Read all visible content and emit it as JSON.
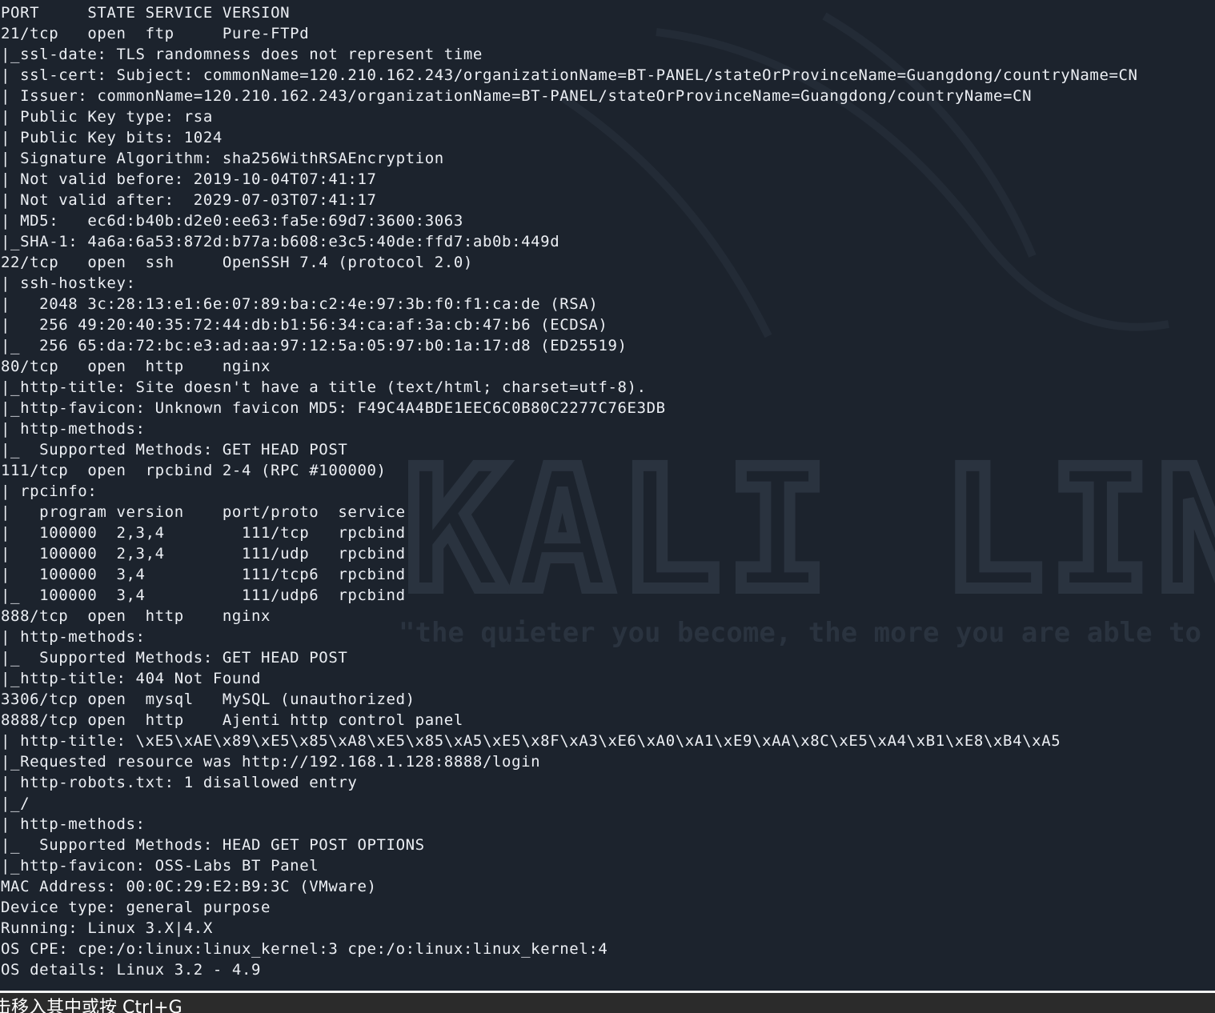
{
  "terminal": {
    "lines": [
      "PORT     STATE SERVICE VERSION",
      "21/tcp   open  ftp     Pure-FTPd",
      "|_ssl-date: TLS randomness does not represent time",
      "| ssl-cert: Subject: commonName=120.210.162.243/organizationName=BT-PANEL/stateOrProvinceName=Guangdong/countryName=CN",
      "| Issuer: commonName=120.210.162.243/organizationName=BT-PANEL/stateOrProvinceName=Guangdong/countryName=CN",
      "| Public Key type: rsa",
      "| Public Key bits: 1024",
      "| Signature Algorithm: sha256WithRSAEncryption",
      "| Not valid before: 2019-10-04T07:41:17",
      "| Not valid after:  2029-07-03T07:41:17",
      "| MD5:   ec6d:b40b:d2e0:ee63:fa5e:69d7:3600:3063",
      "|_SHA-1: 4a6a:6a53:872d:b77a:b608:e3c5:40de:ffd7:ab0b:449d",
      "22/tcp   open  ssh     OpenSSH 7.4 (protocol 2.0)",
      "| ssh-hostkey:",
      "|   2048 3c:28:13:e1:6e:07:89:ba:c2:4e:97:3b:f0:f1:ca:de (RSA)",
      "|   256 49:20:40:35:72:44:db:b1:56:34:ca:af:3a:cb:47:b6 (ECDSA)",
      "|_  256 65:da:72:bc:e3:ad:aa:97:12:5a:05:97:b0:1a:17:d8 (ED25519)",
      "80/tcp   open  http    nginx",
      "|_http-title: Site doesn't have a title (text/html; charset=utf-8).",
      "|_http-favicon: Unknown favicon MD5: F49C4A4BDE1EEC6C0B80C2277C76E3DB",
      "| http-methods:",
      "|_  Supported Methods: GET HEAD POST",
      "111/tcp  open  rpcbind 2-4 (RPC #100000)",
      "| rpcinfo:",
      "|   program version    port/proto  service",
      "|   100000  2,3,4        111/tcp   rpcbind",
      "|   100000  2,3,4        111/udp   rpcbind",
      "|   100000  3,4          111/tcp6  rpcbind",
      "|_  100000  3,4          111/udp6  rpcbind",
      "888/tcp  open  http    nginx",
      "| http-methods:",
      "|_  Supported Methods: GET HEAD POST",
      "|_http-title: 404 Not Found",
      "3306/tcp open  mysql   MySQL (unauthorized)",
      "8888/tcp open  http    Ajenti http control panel",
      "| http-title: \\xE5\\xAE\\x89\\xE5\\x85\\xA8\\xE5\\x85\\xA5\\xE5\\x8F\\xA3\\xE6\\xA0\\xA1\\xE9\\xAA\\x8C\\xE5\\xA4\\xB1\\xE8\\xB4\\xA5",
      "|_Requested resource was http://192.168.1.128:8888/login",
      "| http-robots.txt: 1 disallowed entry",
      "|_/",
      "| http-methods:",
      "|_  Supported Methods: HEAD GET POST OPTIONS",
      "|_http-favicon: OSS-Labs BT Panel",
      "MAC Address: 00:0C:29:E2:B9:3C (VMware)",
      "Device type: general purpose",
      "Running: Linux 3.X|4.X",
      "OS CPE: cpe:/o:linux:linux_kernel:3 cpe:/o:linux:linux_kernel:4",
      "OS details: Linux 3.2 - 4.9"
    ]
  },
  "wallpaper": {
    "logo_text": "KALI LINUX",
    "quote": "\"the quieter you become, the more you are able to h"
  },
  "statusbar": {
    "text": "击移入其中或按 Ctrl+G"
  },
  "colors": {
    "terminal_background": "#1c232d",
    "terminal_foreground": "#eceff4",
    "watermark": "#2a333f",
    "statusbar_background": "#2b2b2b"
  }
}
